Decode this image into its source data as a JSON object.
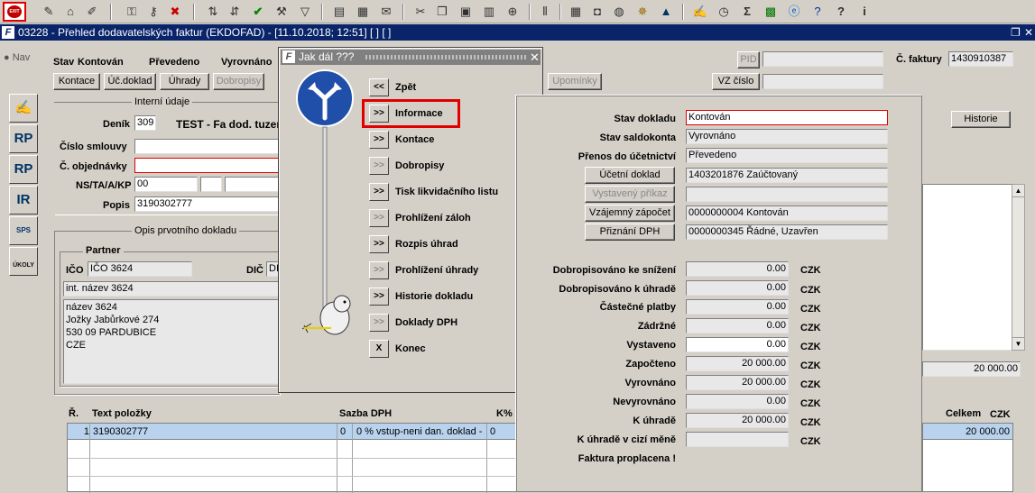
{
  "toolbar": {
    "icons": [
      "exit-button",
      "new-doc",
      "home",
      "edit",
      "sep",
      "lock",
      "lock-edit",
      "delete",
      "sep",
      "sort-asc",
      "sort-desc",
      "check",
      "wrench",
      "filter",
      "sep",
      "print",
      "print-preview",
      "mail",
      "sep",
      "cut",
      "copy",
      "paste",
      "calc",
      "zoom",
      "sep",
      "sort-pipe",
      "sep",
      "calendar",
      "save",
      "globe",
      "ship",
      "fire-ext",
      "sep",
      "edit-note",
      "clock",
      "sigma",
      "excel",
      "word",
      "help",
      "help2",
      "info"
    ],
    "exit_label": "EXIT"
  },
  "window": {
    "title": "03228 - Přehled dodavatelských faktur (EKDOFAD) - [11.10.2018; 12:51]  [ ]  [ ]"
  },
  "nav_label": "Nav",
  "form": {
    "stav_label": "Stav",
    "stav_value": "Kontován",
    "prevedeno": "Převedeno",
    "vyrovnano": "Vyrovnáno",
    "buttons": {
      "kontace": "Kontace",
      "uc_doklad": "Úč.doklad",
      "uhrady": "Úhrady",
      "dobropisy": "Dobropisy",
      "upominky": "Upomínky",
      "vz_cislo": "VZ číslo",
      "historie": "Historie",
      "pid": "PID"
    },
    "faktury_label": "Č. faktury",
    "faktury_value": "1430910387",
    "interni_udaje": "Interní údaje",
    "denik_label": "Deník",
    "denik_value": "309",
    "denik_text": "TEST - Fa dod. tuzem",
    "cislo_smlouvy_label": "Číslo smlouvy",
    "cislo_objednavky_label": "Č. objednávky",
    "ns_label": "NS/TA/A/KP",
    "ns_value": "00",
    "popis_label": "Popis",
    "popis_value": "3190302777",
    "opis_label": "Opis prvotního dokladu",
    "partner_label": "Partner",
    "ico_label": "IČO",
    "ico_value": "IČO 3624",
    "dic_label": "DIČ",
    "dic_value": "DI",
    "int_nazev": "int. název 3624",
    "address": [
      "název 3624",
      "Jožky Jabůrkové 274",
      "530 09 PARDUBICE",
      "CZE"
    ],
    "right_total": "20 000.00"
  },
  "table": {
    "headers": {
      "r": "Ř.",
      "text": "Text položky",
      "sazba": "Sazba DPH",
      "k": "K%",
      "celkem": "Celkem",
      "czk": "CZK"
    },
    "row1": {
      "r": "1",
      "text": "3190302777",
      "sazba_code": "0",
      "sazba_text": "0 % vstup-neni dan. doklad -",
      "k": "0",
      "celkem": "20 000.00"
    }
  },
  "sidebar": [
    "RP",
    "RP",
    "IR",
    "SPS",
    "ÚKOLY"
  ],
  "dialog": {
    "title": "Jak dál ???",
    "items": [
      {
        "btn": "<<",
        "label": "Zpět",
        "enabled": true
      },
      {
        "btn": ">>",
        "label": "Informace",
        "enabled": true
      },
      {
        "btn": ">>",
        "label": "Kontace",
        "enabled": true
      },
      {
        "btn": ">>",
        "label": "Dobropisy",
        "enabled": false
      },
      {
        "btn": ">>",
        "label": "Tisk likvidačního listu",
        "enabled": true
      },
      {
        "btn": ">>",
        "label": "Prohlížení záloh",
        "enabled": false
      },
      {
        "btn": ">>",
        "label": "Rozpis úhrad",
        "enabled": true
      },
      {
        "btn": ">>",
        "label": "Prohlížení úhrady",
        "enabled": false
      },
      {
        "btn": ">>",
        "label": "Historie dokladu",
        "enabled": true
      },
      {
        "btn": ">>",
        "label": "Doklady DPH",
        "enabled": false
      },
      {
        "btn": "X",
        "label": "Konec",
        "enabled": true
      }
    ]
  },
  "info": {
    "stav_dokladu_label": "Stav dokladu",
    "stav_dokladu": "Kontován",
    "stav_saldokonta_label": "Stav saldokonta",
    "stav_saldokonta": "Vyrovnáno",
    "prenos_label": "Přenos do účetnictví",
    "prenos": "Převedeno",
    "ucetni_doklad_btn": "Účetní doklad",
    "ucetni_doklad": "1403201876 Zaúčtovaný",
    "vystaveny_prikaz_btn": "Vystavený příkaz",
    "vystaveny_prikaz": "",
    "vzajemny_btn": "Vzájemný zápočet",
    "vzajemny": "0000000004 Kontován",
    "priznani_btn": "Přiznání DPH",
    "priznani": "0000000345 Řádné, Uzavřen",
    "currency": "CZK",
    "amounts": [
      {
        "label": "Dobropisováno ke snížení",
        "value": "0.00",
        "ro": true
      },
      {
        "label": "Dobropisováno k úhradě",
        "value": "0.00",
        "ro": true
      },
      {
        "label": "Částečné platby",
        "value": "0.00",
        "ro": true
      },
      {
        "label": "Zádržné",
        "value": "0.00",
        "ro": true
      },
      {
        "label": "Vystaveno",
        "value": "0.00",
        "ro": false
      },
      {
        "label": "Započteno",
        "value": "20 000.00",
        "ro": true
      },
      {
        "label": "Vyrovnáno",
        "value": "20 000.00",
        "ro": true
      },
      {
        "label": "Nevyrovnáno",
        "value": "0.00",
        "ro": true
      },
      {
        "label": "K úhradě",
        "value": "20 000.00",
        "ro": true
      },
      {
        "label": "K úhradě v cizí měně",
        "value": "",
        "ro": true
      }
    ],
    "proplacena": "Faktura proplacena !"
  }
}
